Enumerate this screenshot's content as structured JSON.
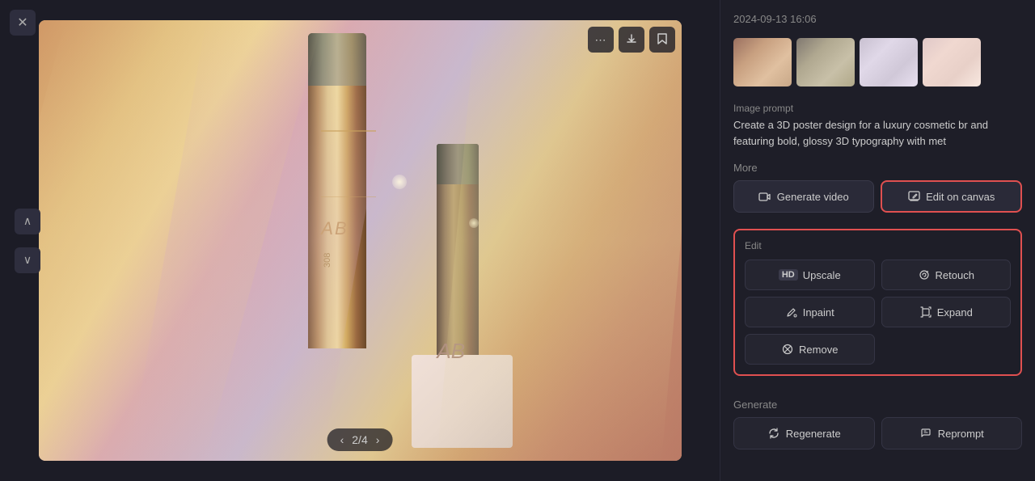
{
  "header": {
    "timestamp": "2024-09-13 16:06"
  },
  "viewer": {
    "page_current": "2",
    "page_total": "4",
    "page_indicator": "2/4"
  },
  "top_controls": {
    "more_btn": "⋯",
    "download_btn": "↓",
    "bookmark_btn": "🔖"
  },
  "right_panel": {
    "image_prompt_label": "Image prompt",
    "image_prompt_text": "Create a 3D poster design for a luxury cosmetic br and featuring bold, glossy 3D typography with met",
    "more_label": "More",
    "generate_video_label": "Generate video",
    "edit_on_canvas_label": "Edit on canvas",
    "edit_label": "Edit",
    "upscale_label": "Upscale",
    "retouch_label": "Retouch",
    "inpaint_label": "Inpaint",
    "expand_label": "Expand",
    "remove_label": "Remove",
    "generate_label": "Generate",
    "regenerate_label": "Regenerate",
    "reprompt_label": "Reprompt"
  },
  "nav": {
    "close": "✕",
    "up": "∧",
    "down": "∨",
    "prev": "‹",
    "next": "›"
  }
}
